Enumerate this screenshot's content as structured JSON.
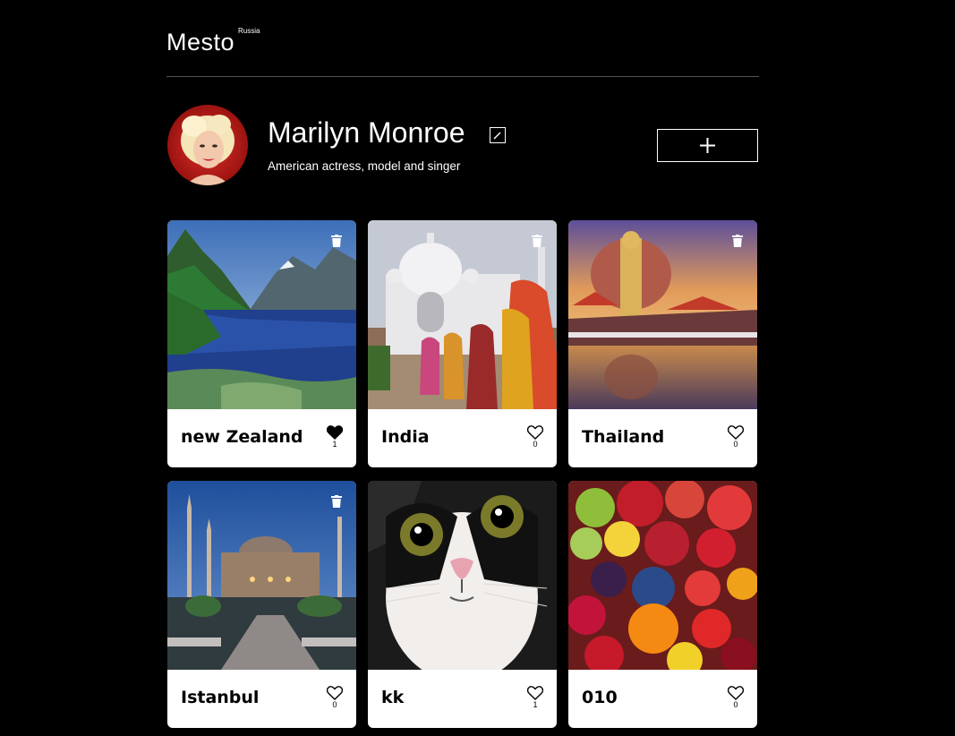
{
  "header": {
    "logo": "Mesto",
    "logo_sup": "Russia"
  },
  "profile": {
    "name": "Marilyn Monroe",
    "about": "American actress, model and singer"
  },
  "icons": {
    "edit": "pencil-icon",
    "add": "plus-icon",
    "delete": "trash-icon",
    "like": "heart-icon"
  },
  "cards": [
    {
      "title": "new Zealand",
      "likes": "1",
      "liked": true,
      "deletable": true
    },
    {
      "title": "India",
      "likes": "0",
      "liked": false,
      "deletable": true
    },
    {
      "title": "Thailand",
      "likes": "0",
      "liked": false,
      "deletable": true
    },
    {
      "title": "Istanbul",
      "likes": "0",
      "liked": false,
      "deletable": true
    },
    {
      "title": "kk",
      "likes": "1",
      "liked": false,
      "deletable": false
    },
    {
      "title": "010",
      "likes": "0",
      "liked": false,
      "deletable": false
    }
  ]
}
